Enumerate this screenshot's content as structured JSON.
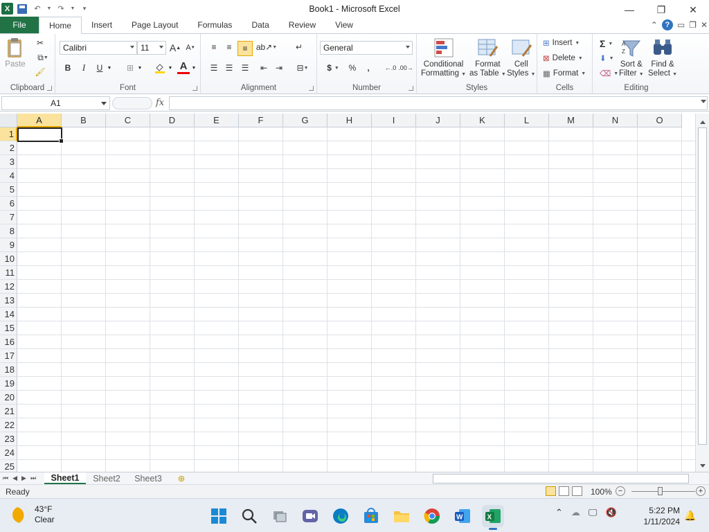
{
  "window": {
    "title": "Book1  -  Microsoft Excel"
  },
  "ribbon_tabs": [
    "File",
    "Home",
    "Insert",
    "Page Layout",
    "Formulas",
    "Data",
    "Review",
    "View"
  ],
  "home": {
    "clipboard": {
      "label": "Clipboard",
      "paste": "Paste"
    },
    "font": {
      "label": "Font",
      "name": "Calibri",
      "size": "11",
      "bold": "B",
      "italic": "I",
      "underline": "U"
    },
    "alignment": {
      "label": "Alignment"
    },
    "number": {
      "label": "Number",
      "format": "General",
      "currency": "$",
      "percent": "%",
      "comma": ","
    },
    "styles": {
      "label": "Styles",
      "conditional": "Conditional",
      "conditional2": "Formatting",
      "format_table": "Format",
      "format_table2": "as Table",
      "cell_styles": "Cell",
      "cell_styles2": "Styles"
    },
    "cells": {
      "label": "Cells",
      "insert": "Insert",
      "delete": "Delete",
      "format": "Format"
    },
    "editing": {
      "label": "Editing",
      "sort": "Sort &",
      "sort2": "Filter",
      "find": "Find &",
      "find2": "Select"
    }
  },
  "formula_bar": {
    "name_box": "A1",
    "fx": "fx",
    "value": ""
  },
  "grid": {
    "columns": [
      "A",
      "B",
      "C",
      "D",
      "E",
      "F",
      "G",
      "H",
      "I",
      "J",
      "K",
      "L",
      "M",
      "N",
      "O"
    ],
    "rows": [
      "1",
      "2",
      "3",
      "4",
      "5",
      "6",
      "7",
      "8",
      "9",
      "10",
      "11",
      "12",
      "13",
      "14",
      "15",
      "16",
      "17",
      "18",
      "19",
      "20",
      "21",
      "22",
      "23",
      "24",
      "25"
    ],
    "active_cell": "A1"
  },
  "sheets": [
    "Sheet1",
    "Sheet2",
    "Sheet3"
  ],
  "active_sheet": "Sheet1",
  "status": {
    "text": "Ready",
    "zoom": "100%"
  },
  "taskbar": {
    "weather_temp": "43°F",
    "weather_cond": "Clear",
    "time": "5:22 PM",
    "date": "1/11/2024"
  },
  "colors": {
    "excel_green": "#217346",
    "selection_yellow": "#fbe39d",
    "accent_blue": "#2f74c0"
  }
}
